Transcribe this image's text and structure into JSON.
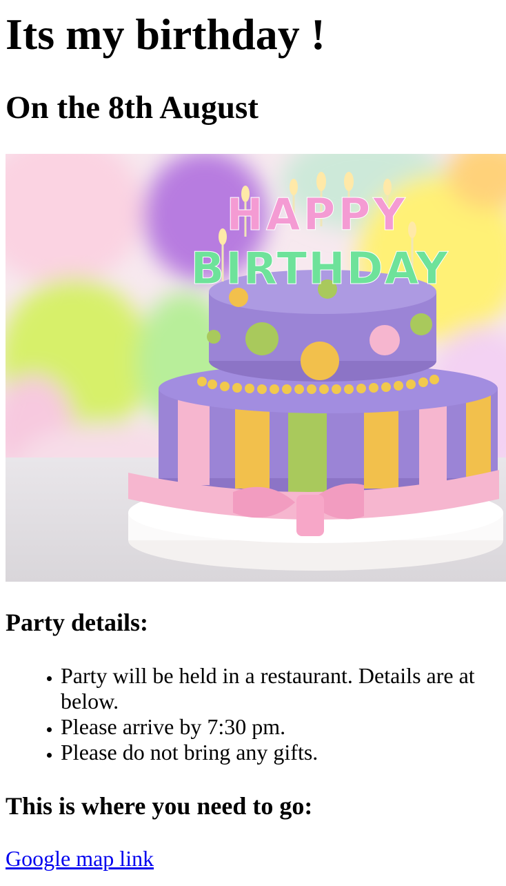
{
  "heading": "Its my birthday !",
  "subheading": "On the 8th August",
  "image": {
    "subject": "birthday-cake-photo",
    "cake_topper": {
      "line1": "HAPPY",
      "line2": "BIRTHDAY"
    },
    "colors": {
      "cake_purple": "#9b84d6",
      "stripe_yellow": "#f2c04c",
      "stripe_green": "#a9c95c",
      "ribbon_pink": "#f6b6cf"
    }
  },
  "party": {
    "title": "Party details:",
    "items": [
      "Party will be held in a restaurant. Details are at below.",
      "Please arrive by 7:30 pm.",
      "Please do not bring any gifts."
    ]
  },
  "location": {
    "title": "This is where you need to go:",
    "link_text": "Google map link",
    "link_color": "#0000ee"
  }
}
